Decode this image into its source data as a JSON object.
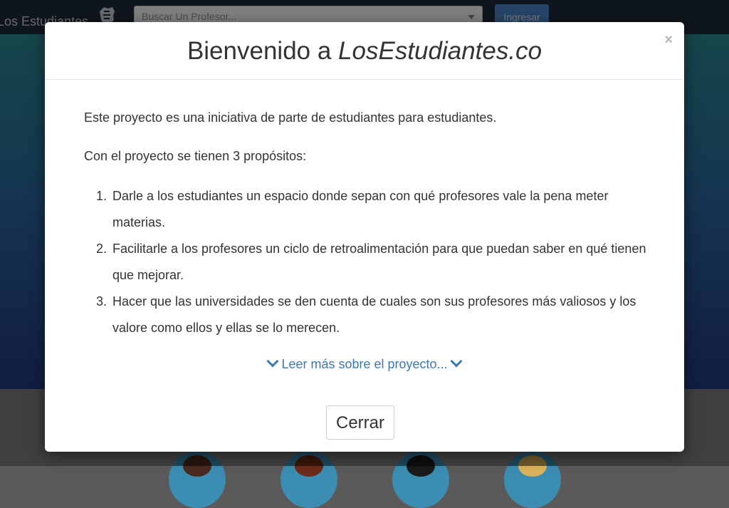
{
  "navbar": {
    "brand": "Los Estudiantes",
    "brand_icon": "fist-logo-icon",
    "search_placeholder": "Buscar Un Profesor...",
    "login_label": "Ingresar"
  },
  "modal": {
    "title_prefix": "Bienvenido a ",
    "title_site": "LosEstudiantes.co",
    "close_symbol": "×",
    "intro": "Este proyecto es una iniciativa de parte de estudiantes para estudiantes.",
    "purposes_intro": "Con el proyecto se tienen 3 propósitos:",
    "purposes": [
      {
        "num": "1.",
        "text": "Darle a los estudiantes un espacio donde sepan con qué profesores vale la pena meter materias."
      },
      {
        "num": "2.",
        "text": "Facilitarle a los profesores un ciclo de retroalimentación para que puedan saber en qué tienen que mejorar."
      },
      {
        "num": "3.",
        "text": "Hacer que las universidades se den cuenta de cuales son sus profesores más valiosos y los valore como ellos y ellas se lo merecen."
      }
    ],
    "read_more": "Leer más sobre el proyecto...",
    "close_button": "Cerrar"
  },
  "colors": {
    "navbar": "#1f2a38",
    "accent": "#4a88cf",
    "link": "#3c78b4"
  }
}
